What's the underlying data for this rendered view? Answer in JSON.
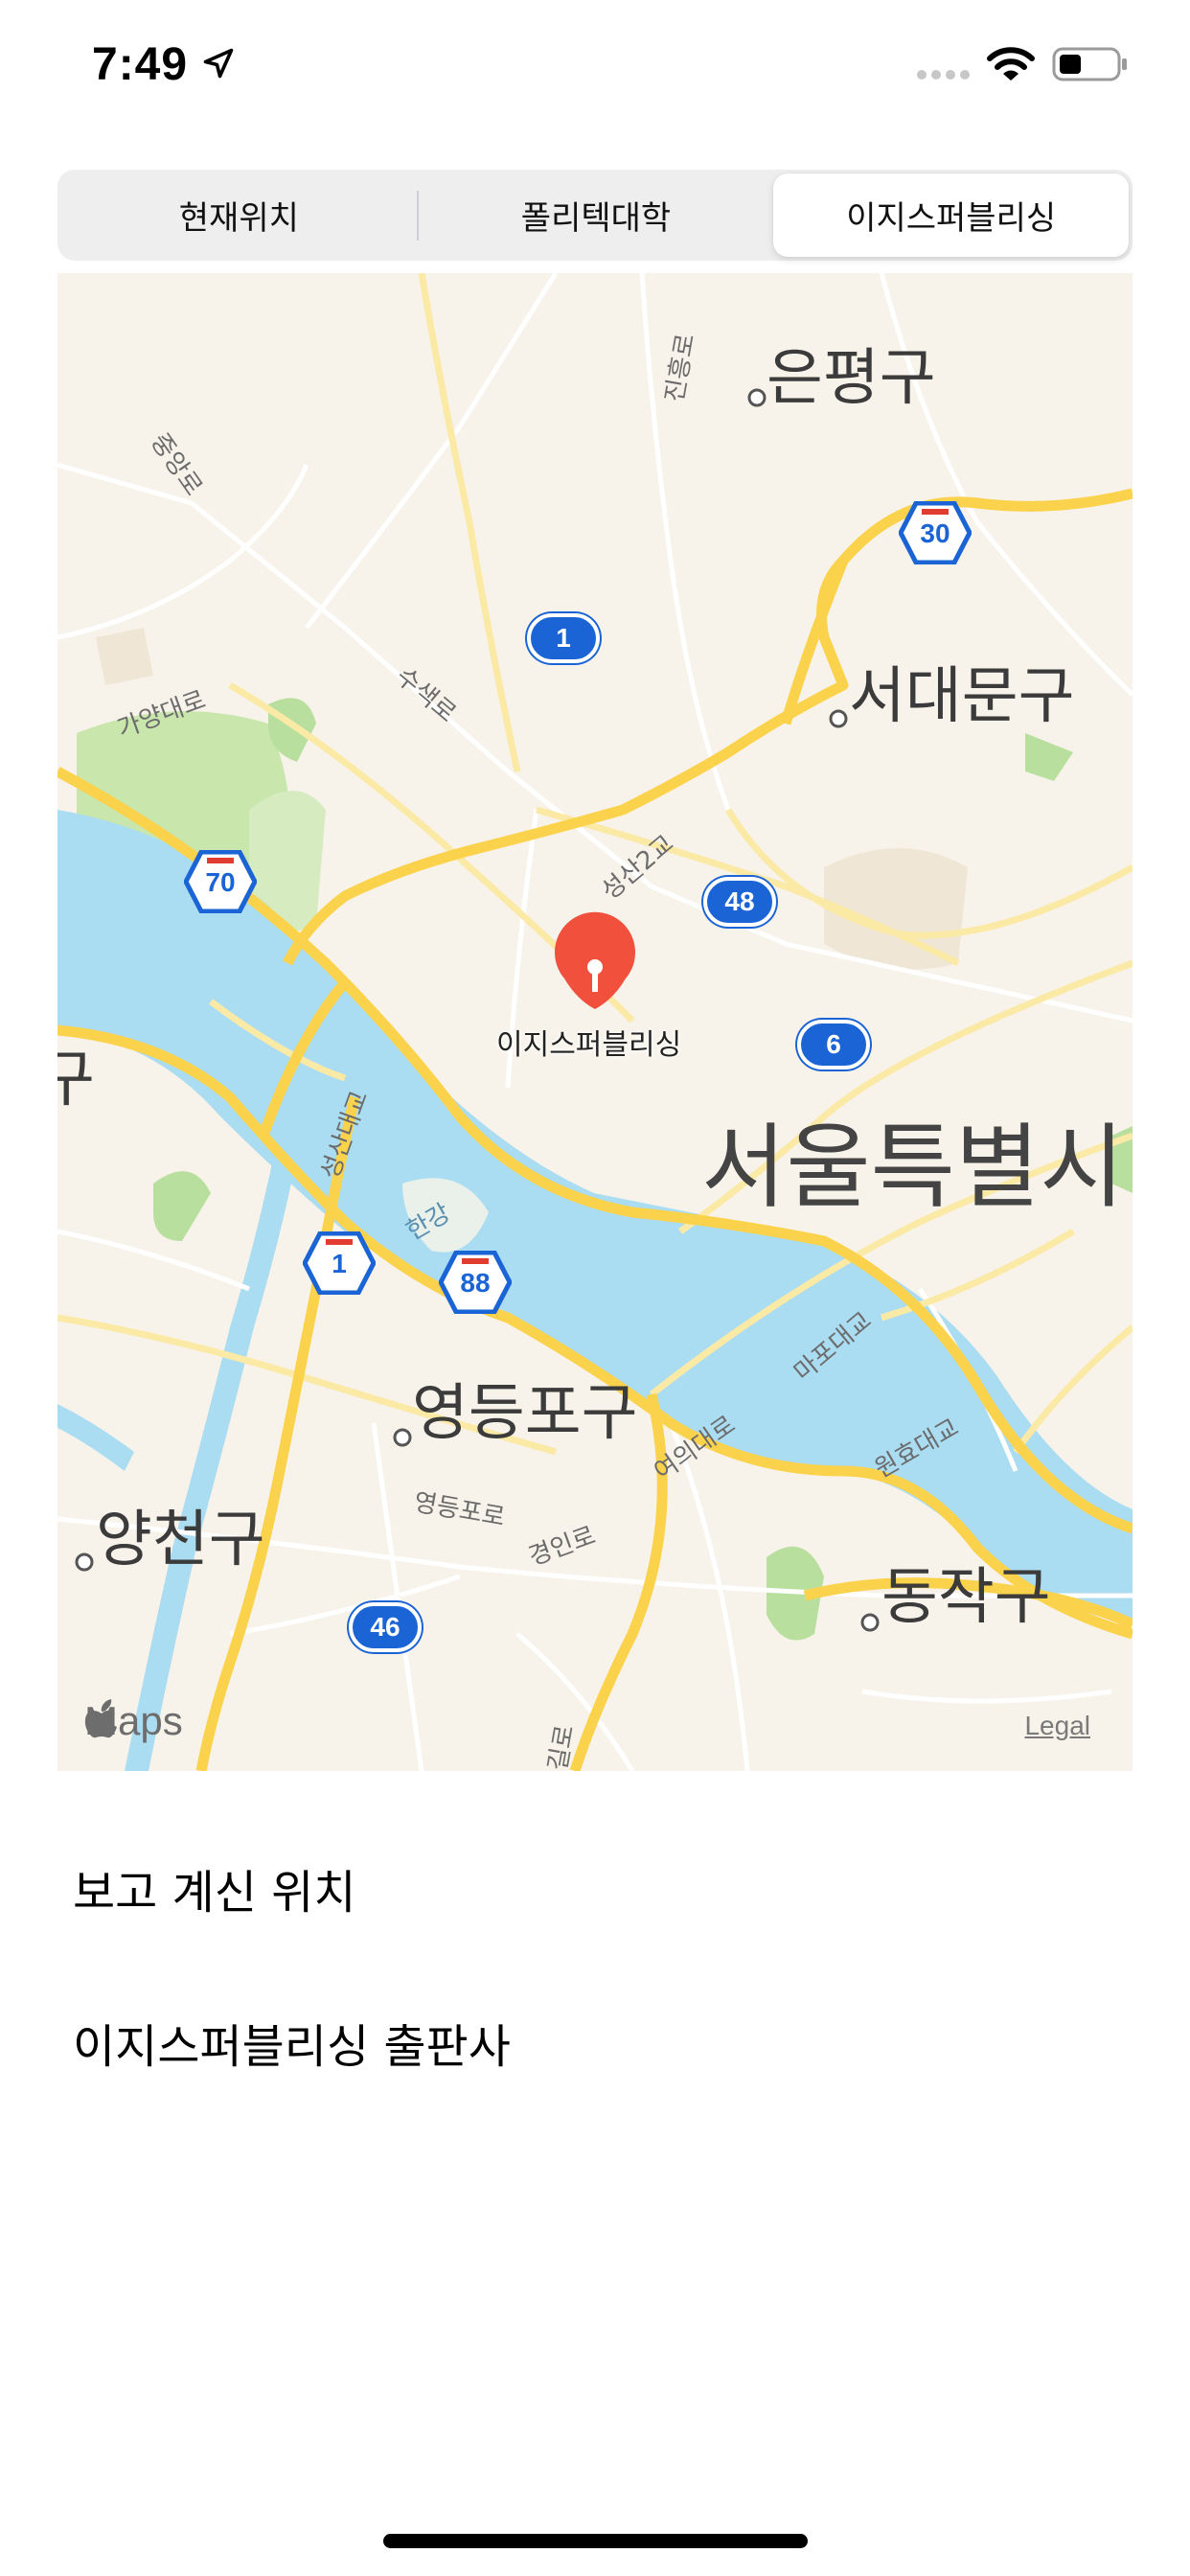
{
  "status_bar": {
    "time": "7:49",
    "icons": [
      "location-arrow-icon",
      "cellular-signal-icon",
      "wifi-icon",
      "battery-icon"
    ]
  },
  "segmented_control": {
    "segments": [
      "현재위치",
      "폴리텍대학",
      "이지스퍼블리싱"
    ],
    "selected_index": 2
  },
  "map": {
    "districts": [
      "은평구",
      "서대문구",
      "영등포구",
      "양천구",
      "동작구",
      "구"
    ],
    "city": "서울특별시",
    "pin_label": "이지스퍼블리싱",
    "road_labels": [
      "중앙로",
      "진흥로",
      "가양대로",
      "수색로",
      "성산2교",
      "성산대교",
      "마포대교",
      "원효대교",
      "여의대로",
      "영등포로",
      "경인로",
      "한강",
      "길로"
    ],
    "highway_shields": [
      "1",
      "30",
      "70",
      "48",
      "6",
      "1",
      "88",
      "46"
    ],
    "attribution": "Maps",
    "legal": "Legal",
    "colors": {
      "land": "#f8f3ea",
      "water": "#aadcf2",
      "park": "#c9e6ad",
      "major_road": "#fbd24b",
      "pin": "#f0503c"
    }
  },
  "list": {
    "items": [
      "보고 계신 위치",
      "이지스퍼블리싱 출판사"
    ]
  }
}
